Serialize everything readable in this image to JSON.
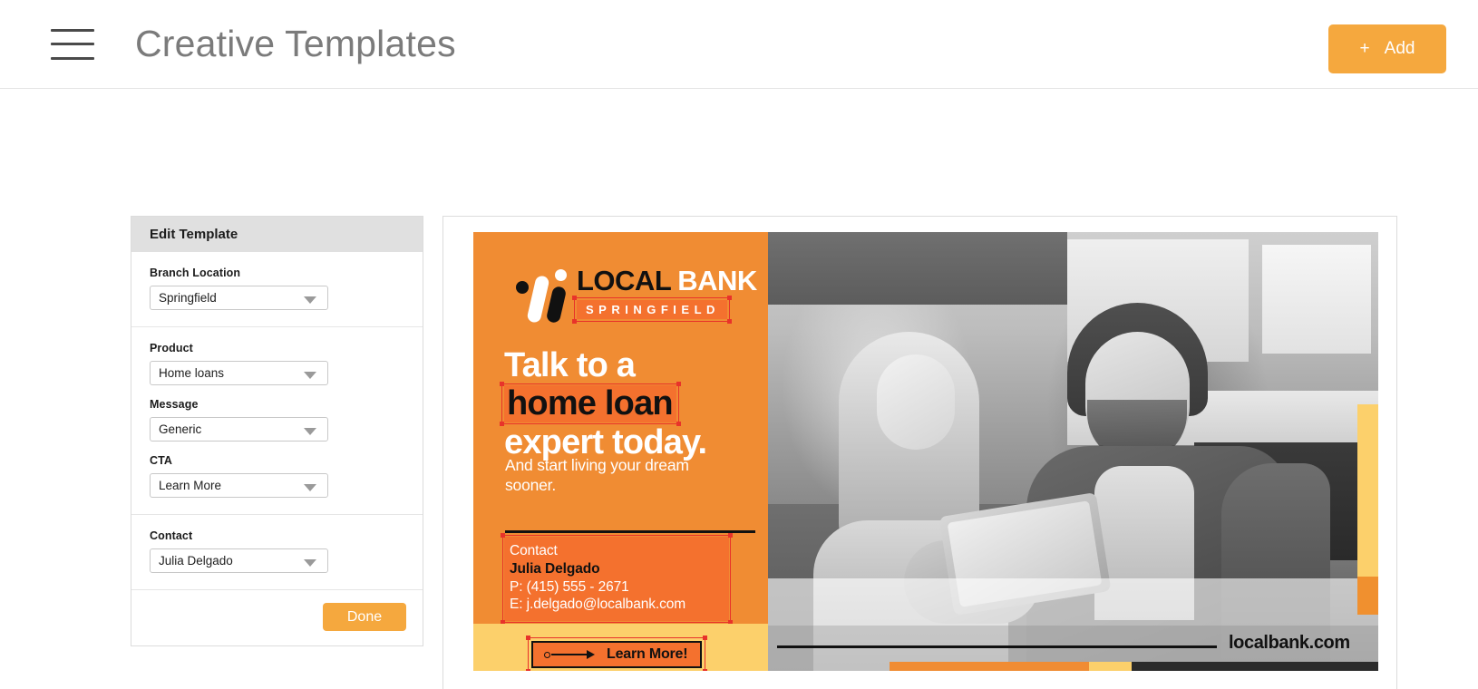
{
  "header": {
    "menu_icon": "hamburger-icon",
    "title": "Creative Templates",
    "add_button": {
      "plus": "+",
      "label": "Add"
    }
  },
  "edit_panel": {
    "heading": "Edit Template",
    "groups": [
      {
        "fields": [
          {
            "label": "Branch Location",
            "value": "Springfield",
            "icon": "chevron-down-icon"
          }
        ]
      },
      {
        "fields": [
          {
            "label": "Product",
            "value": "Home loans",
            "icon": "chevron-down-icon"
          },
          {
            "label": "Message",
            "value": "Generic",
            "icon": "chevron-down-icon"
          },
          {
            "label": "CTA",
            "value": "Learn More",
            "icon": "chevron-down-icon"
          }
        ]
      },
      {
        "fields": [
          {
            "label": "Contact",
            "value": "Julia Delgado",
            "icon": "chevron-down-icon"
          }
        ]
      }
    ],
    "done_label": "Done"
  },
  "creative": {
    "logo": {
      "word1": "LOCAL",
      "word2": "BANK",
      "sub": "SPRINGFIELD"
    },
    "headline": {
      "line1": "Talk to a",
      "line2": "home loan",
      "line3": "expert today."
    },
    "subhead": "And start living your dream sooner.",
    "contact": {
      "label": "Contact",
      "name": "Julia Delgado",
      "phone": "P: (415) 555 - 2671",
      "email": "E: j.delgado@localbank.com"
    },
    "cta": {
      "label": "Learn More!",
      "icon": "arrow-right-icon"
    },
    "url": "localbank.com",
    "colors": {
      "brand_orange": "#f08c33",
      "accent_orange": "#f4712e",
      "accent_yellow": "#fcd06b",
      "button_amber": "#f5a83e",
      "selection_red": "#e8332a",
      "dark": "#111111"
    }
  }
}
